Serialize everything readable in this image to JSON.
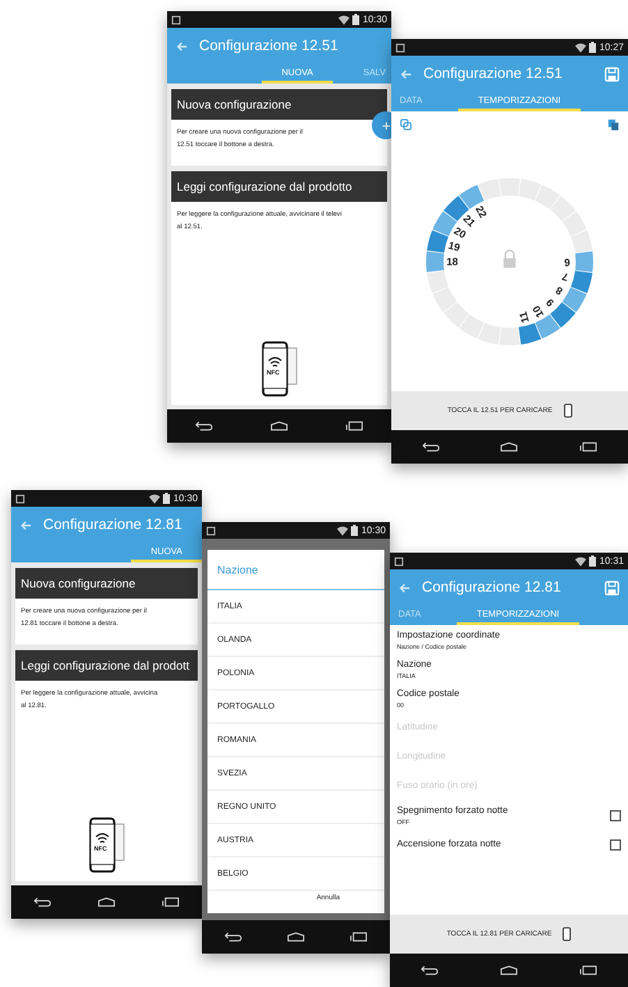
{
  "phones": [
    {
      "kind": "start",
      "time": "10:30",
      "title": "Configurazione 12.51",
      "add_button": true,
      "tabs": [
        {
          "label": "NUOVA",
          "selected": true
        },
        {
          "label": "SALV",
          "selected": false
        }
      ],
      "sections": [
        {
          "heading": "Nuova configurazione",
          "text": "Per creare una nuova configurazione per il\n12.51 toccare il bottone a destra."
        },
        {
          "heading": "Leggi configurazione dal prodotto",
          "text": "Per leggere la configurazione attuale, avvicinare il televi\nal 12.51."
        }
      ],
      "nfc_label": "NFC"
    },
    {
      "kind": "dial",
      "time": "10:27",
      "title": "Configurazione 12.51",
      "save_icon": true,
      "tabs": [
        {
          "label": "DATA",
          "selected": false
        },
        {
          "label": "TEMPORIZZAZIONI",
          "selected": true
        }
      ],
      "segments": [
        {
          "on": false
        },
        {
          "on": false
        },
        {
          "on": false
        },
        {
          "on": false
        },
        {
          "on": false
        },
        {
          "on": false
        },
        {
          "on": true,
          "label": "6"
        },
        {
          "on": true,
          "label": "7"
        },
        {
          "on": true,
          "label": "8"
        },
        {
          "on": true,
          "label": "9"
        },
        {
          "on": true,
          "label": "10"
        },
        {
          "on": true,
          "label": "11"
        },
        {
          "on": false
        },
        {
          "on": false
        },
        {
          "on": false
        },
        {
          "on": false
        },
        {
          "on": false
        },
        {
          "on": false
        },
        {
          "on": true,
          "label": "18"
        },
        {
          "on": true,
          "label": "19"
        },
        {
          "on": true,
          "label": "20"
        },
        {
          "on": true,
          "label": "21"
        },
        {
          "on": true,
          "label": "22"
        },
        {
          "on": false
        }
      ],
      "footer": "TOCCA IL 12.51 PER CARICARE"
    },
    {
      "kind": "start",
      "time": "10:30",
      "title": "Configurazione 12.81",
      "tabs": [
        {
          "label": "NUOVA",
          "selected": true
        }
      ],
      "sections": [
        {
          "heading": "Nuova configurazione",
          "text": "Per creare una nuova configurazione per il\n12.81 toccare il bottone a destra."
        },
        {
          "heading": "Leggi configurazione dal prodott",
          "text": "Per leggere la configurazione attuale, avvicina\nal 12.81."
        }
      ],
      "nfc_label": "NFC"
    },
    {
      "kind": "dialog",
      "time": "10:30",
      "dialog_title": "Nazione",
      "options": [
        "ITALIA",
        "OLANDA",
        "POLONIA",
        "PORTOGALLO",
        "ROMANIA",
        "SVEZIA",
        "REGNO UNITO",
        "AUSTRIA",
        "BELGIO"
      ],
      "cancel": "Annulla"
    },
    {
      "kind": "settings",
      "time": "10:31",
      "title": "Configurazione 12.81",
      "save_icon": true,
      "tabs": [
        {
          "label": "DATA",
          "selected": false
        },
        {
          "label": "TEMPORIZZAZIONI",
          "selected": true
        }
      ],
      "items": [
        {
          "kind": "field",
          "title": "Impostazione coordinate",
          "value": "Nazione / Codice postale",
          "disabled": false
        },
        {
          "kind": "field",
          "title": "Nazione",
          "value": "ITALIA",
          "disabled": false
        },
        {
          "kind": "field",
          "title": "Codice postale",
          "value": "00",
          "disabled": false
        },
        {
          "kind": "field",
          "title": "Latitudine",
          "disabled": true
        },
        {
          "kind": "field",
          "title": "Longitudine",
          "disabled": true
        },
        {
          "kind": "field",
          "title": "Fuso orario (in ore)",
          "disabled": true
        },
        {
          "kind": "toggle",
          "title": "Spegnimento forzato notte",
          "value": "OFF",
          "checked": false
        },
        {
          "kind": "toggle",
          "title": "Accensione forzata notte",
          "checked": false
        }
      ],
      "footer": "TOCCA IL 12.81 PER CARICARE"
    }
  ]
}
